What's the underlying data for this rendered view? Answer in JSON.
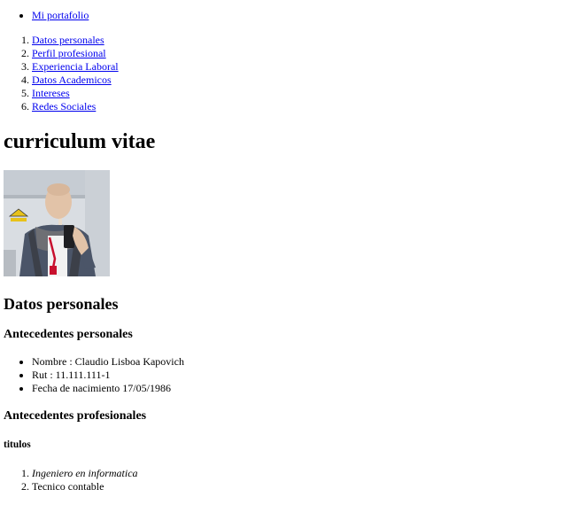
{
  "nav": {
    "top_link": "Mi portafolio",
    "sections": [
      "Datos personales",
      "Perfil profesional",
      "Experiencia Laboral",
      "Datos Academicos",
      "Intereses",
      "Redes Sociales"
    ]
  },
  "main": {
    "title": "curriculum vitae",
    "photo_icon": "profile-photo",
    "personal_heading": "Datos personales",
    "personal_background_heading": "Antecedentes personales",
    "personal_items": [
      "Nombre : Claudio Lisboa Kapovich",
      "Rut : 11.111.111-1",
      "Fecha de nacimiento 17/05/1986"
    ],
    "professional_background_heading": "Antecedentes profesionales",
    "titles_heading": "titulos",
    "titles": [
      "Ingeniero en informatica",
      "Tecnico contable"
    ]
  },
  "colors": {
    "link": "#0000ee",
    "text": "#000000",
    "background": "#ffffff"
  }
}
